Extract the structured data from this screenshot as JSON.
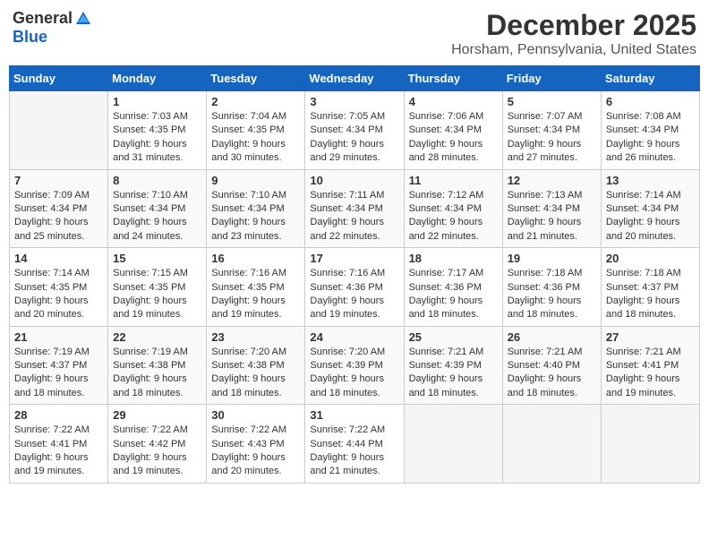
{
  "header": {
    "logo_general": "General",
    "logo_blue": "Blue",
    "month_title": "December 2025",
    "location": "Horsham, Pennsylvania, United States"
  },
  "days_of_week": [
    "Sunday",
    "Monday",
    "Tuesday",
    "Wednesday",
    "Thursday",
    "Friday",
    "Saturday"
  ],
  "weeks": [
    [
      {
        "day": "",
        "sunrise": "",
        "sunset": "",
        "daylight": ""
      },
      {
        "day": "1",
        "sunrise": "Sunrise: 7:03 AM",
        "sunset": "Sunset: 4:35 PM",
        "daylight": "Daylight: 9 hours and 31 minutes."
      },
      {
        "day": "2",
        "sunrise": "Sunrise: 7:04 AM",
        "sunset": "Sunset: 4:35 PM",
        "daylight": "Daylight: 9 hours and 30 minutes."
      },
      {
        "day": "3",
        "sunrise": "Sunrise: 7:05 AM",
        "sunset": "Sunset: 4:34 PM",
        "daylight": "Daylight: 9 hours and 29 minutes."
      },
      {
        "day": "4",
        "sunrise": "Sunrise: 7:06 AM",
        "sunset": "Sunset: 4:34 PM",
        "daylight": "Daylight: 9 hours and 28 minutes."
      },
      {
        "day": "5",
        "sunrise": "Sunrise: 7:07 AM",
        "sunset": "Sunset: 4:34 PM",
        "daylight": "Daylight: 9 hours and 27 minutes."
      },
      {
        "day": "6",
        "sunrise": "Sunrise: 7:08 AM",
        "sunset": "Sunset: 4:34 PM",
        "daylight": "Daylight: 9 hours and 26 minutes."
      }
    ],
    [
      {
        "day": "7",
        "sunrise": "Sunrise: 7:09 AM",
        "sunset": "Sunset: 4:34 PM",
        "daylight": "Daylight: 9 hours and 25 minutes."
      },
      {
        "day": "8",
        "sunrise": "Sunrise: 7:10 AM",
        "sunset": "Sunset: 4:34 PM",
        "daylight": "Daylight: 9 hours and 24 minutes."
      },
      {
        "day": "9",
        "sunrise": "Sunrise: 7:10 AM",
        "sunset": "Sunset: 4:34 PM",
        "daylight": "Daylight: 9 hours and 23 minutes."
      },
      {
        "day": "10",
        "sunrise": "Sunrise: 7:11 AM",
        "sunset": "Sunset: 4:34 PM",
        "daylight": "Daylight: 9 hours and 22 minutes."
      },
      {
        "day": "11",
        "sunrise": "Sunrise: 7:12 AM",
        "sunset": "Sunset: 4:34 PM",
        "daylight": "Daylight: 9 hours and 22 minutes."
      },
      {
        "day": "12",
        "sunrise": "Sunrise: 7:13 AM",
        "sunset": "Sunset: 4:34 PM",
        "daylight": "Daylight: 9 hours and 21 minutes."
      },
      {
        "day": "13",
        "sunrise": "Sunrise: 7:14 AM",
        "sunset": "Sunset: 4:34 PM",
        "daylight": "Daylight: 9 hours and 20 minutes."
      }
    ],
    [
      {
        "day": "14",
        "sunrise": "Sunrise: 7:14 AM",
        "sunset": "Sunset: 4:35 PM",
        "daylight": "Daylight: 9 hours and 20 minutes."
      },
      {
        "day": "15",
        "sunrise": "Sunrise: 7:15 AM",
        "sunset": "Sunset: 4:35 PM",
        "daylight": "Daylight: 9 hours and 19 minutes."
      },
      {
        "day": "16",
        "sunrise": "Sunrise: 7:16 AM",
        "sunset": "Sunset: 4:35 PM",
        "daylight": "Daylight: 9 hours and 19 minutes."
      },
      {
        "day": "17",
        "sunrise": "Sunrise: 7:16 AM",
        "sunset": "Sunset: 4:36 PM",
        "daylight": "Daylight: 9 hours and 19 minutes."
      },
      {
        "day": "18",
        "sunrise": "Sunrise: 7:17 AM",
        "sunset": "Sunset: 4:36 PM",
        "daylight": "Daylight: 9 hours and 18 minutes."
      },
      {
        "day": "19",
        "sunrise": "Sunrise: 7:18 AM",
        "sunset": "Sunset: 4:36 PM",
        "daylight": "Daylight: 9 hours and 18 minutes."
      },
      {
        "day": "20",
        "sunrise": "Sunrise: 7:18 AM",
        "sunset": "Sunset: 4:37 PM",
        "daylight": "Daylight: 9 hours and 18 minutes."
      }
    ],
    [
      {
        "day": "21",
        "sunrise": "Sunrise: 7:19 AM",
        "sunset": "Sunset: 4:37 PM",
        "daylight": "Daylight: 9 hours and 18 minutes."
      },
      {
        "day": "22",
        "sunrise": "Sunrise: 7:19 AM",
        "sunset": "Sunset: 4:38 PM",
        "daylight": "Daylight: 9 hours and 18 minutes."
      },
      {
        "day": "23",
        "sunrise": "Sunrise: 7:20 AM",
        "sunset": "Sunset: 4:38 PM",
        "daylight": "Daylight: 9 hours and 18 minutes."
      },
      {
        "day": "24",
        "sunrise": "Sunrise: 7:20 AM",
        "sunset": "Sunset: 4:39 PM",
        "daylight": "Daylight: 9 hours and 18 minutes."
      },
      {
        "day": "25",
        "sunrise": "Sunrise: 7:21 AM",
        "sunset": "Sunset: 4:39 PM",
        "daylight": "Daylight: 9 hours and 18 minutes."
      },
      {
        "day": "26",
        "sunrise": "Sunrise: 7:21 AM",
        "sunset": "Sunset: 4:40 PM",
        "daylight": "Daylight: 9 hours and 18 minutes."
      },
      {
        "day": "27",
        "sunrise": "Sunrise: 7:21 AM",
        "sunset": "Sunset: 4:41 PM",
        "daylight": "Daylight: 9 hours and 19 minutes."
      }
    ],
    [
      {
        "day": "28",
        "sunrise": "Sunrise: 7:22 AM",
        "sunset": "Sunset: 4:41 PM",
        "daylight": "Daylight: 9 hours and 19 minutes."
      },
      {
        "day": "29",
        "sunrise": "Sunrise: 7:22 AM",
        "sunset": "Sunset: 4:42 PM",
        "daylight": "Daylight: 9 hours and 19 minutes."
      },
      {
        "day": "30",
        "sunrise": "Sunrise: 7:22 AM",
        "sunset": "Sunset: 4:43 PM",
        "daylight": "Daylight: 9 hours and 20 minutes."
      },
      {
        "day": "31",
        "sunrise": "Sunrise: 7:22 AM",
        "sunset": "Sunset: 4:44 PM",
        "daylight": "Daylight: 9 hours and 21 minutes."
      },
      {
        "day": "",
        "sunrise": "",
        "sunset": "",
        "daylight": ""
      },
      {
        "day": "",
        "sunrise": "",
        "sunset": "",
        "daylight": ""
      },
      {
        "day": "",
        "sunrise": "",
        "sunset": "",
        "daylight": ""
      }
    ]
  ]
}
